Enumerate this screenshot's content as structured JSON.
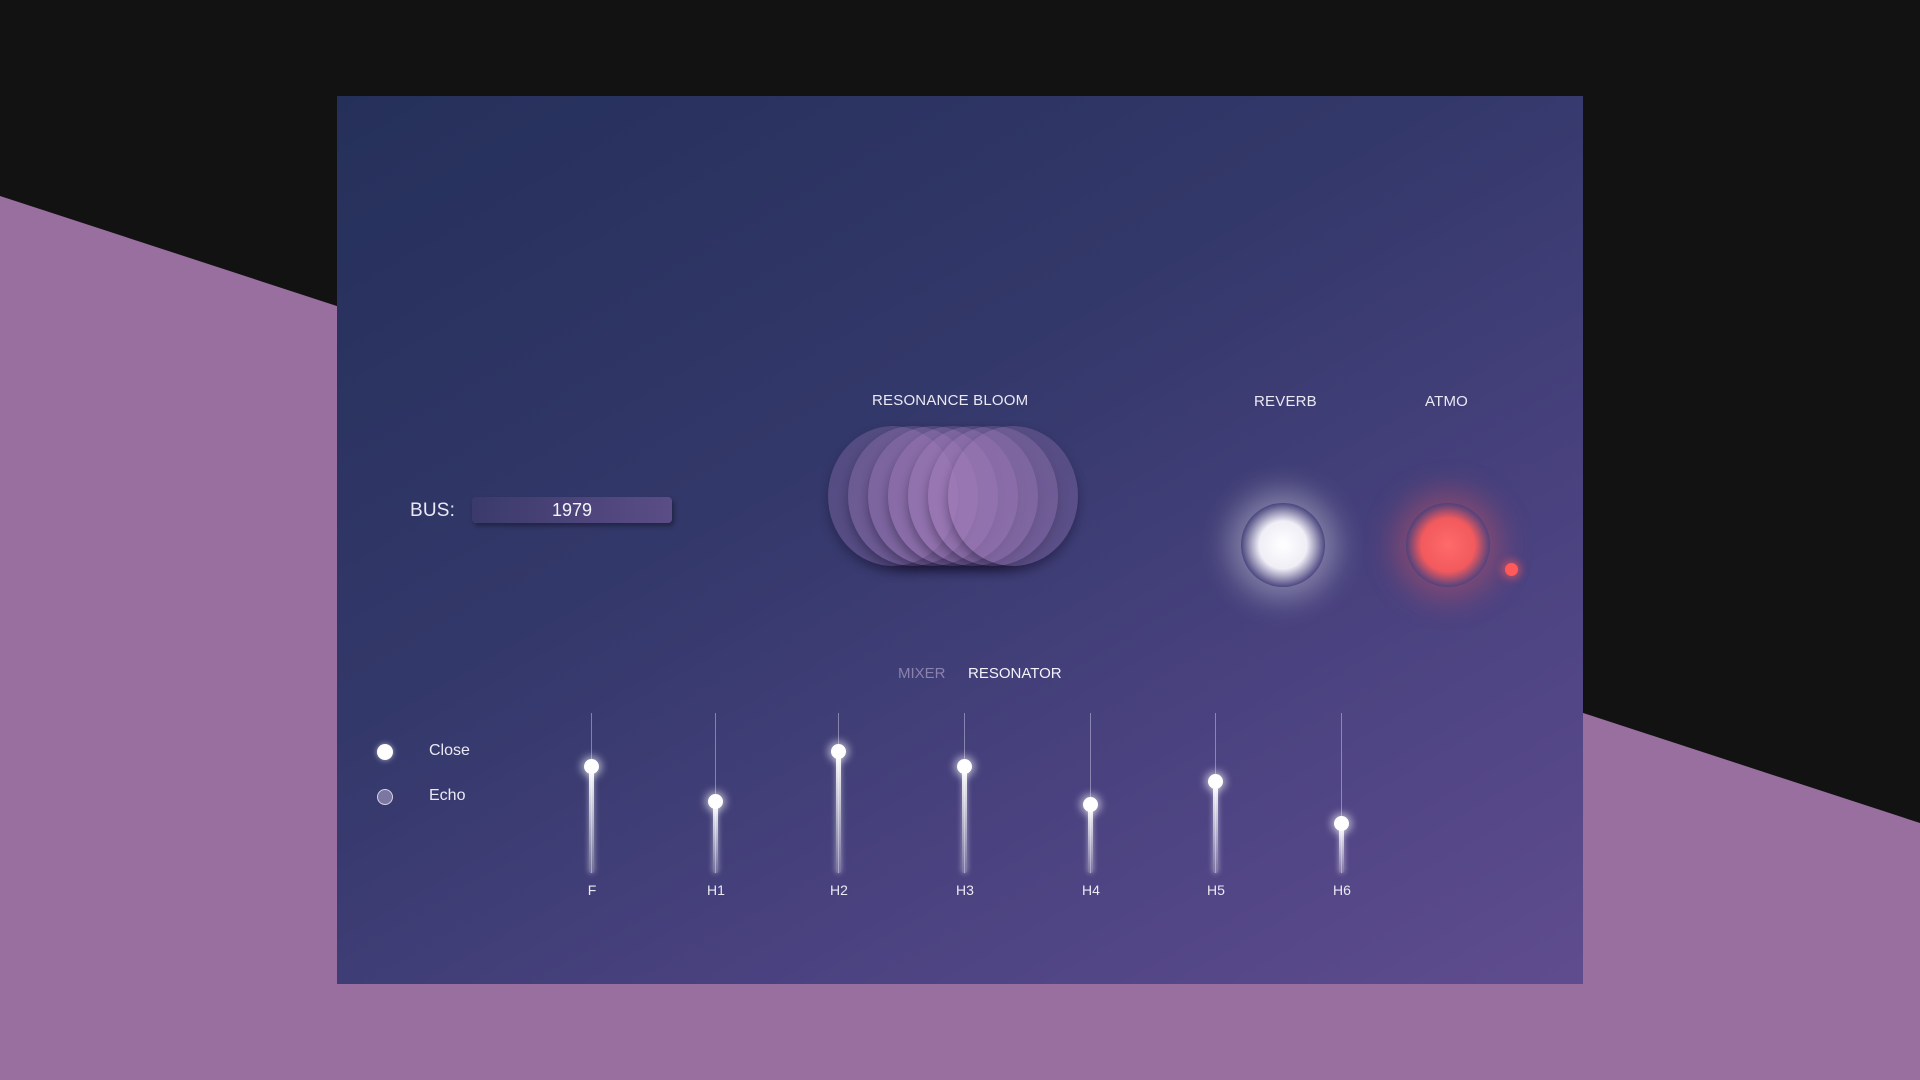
{
  "colors": {
    "panel_start": "#25305a",
    "panel_end": "#5f4c8f",
    "outer_purple": "#996f9f",
    "outer_dark": "#121212",
    "atmo_red": "#f25a5e",
    "reverb_white": "#ffffff"
  },
  "bus": {
    "label": "BUS:",
    "value": "1979"
  },
  "sections": {
    "resonance_bloom": "RESONANCE BLOOM",
    "reverb": "REVERB",
    "atmo": "ATMO"
  },
  "tabs": [
    {
      "label": "MIXER",
      "active": false
    },
    {
      "label": "RESONATOR",
      "active": true
    }
  ],
  "options": [
    {
      "label": "Close",
      "selected": true
    },
    {
      "label": "Echo",
      "selected": false
    }
  ],
  "sliders": [
    {
      "label": "F",
      "value": 0.68
    },
    {
      "label": "H1",
      "value": 0.45
    },
    {
      "label": "H2",
      "value": 0.78
    },
    {
      "label": "H3",
      "value": 0.68
    },
    {
      "label": "H4",
      "value": 0.43
    },
    {
      "label": "H5",
      "value": 0.58
    },
    {
      "label": "H6",
      "value": 0.3
    }
  ]
}
